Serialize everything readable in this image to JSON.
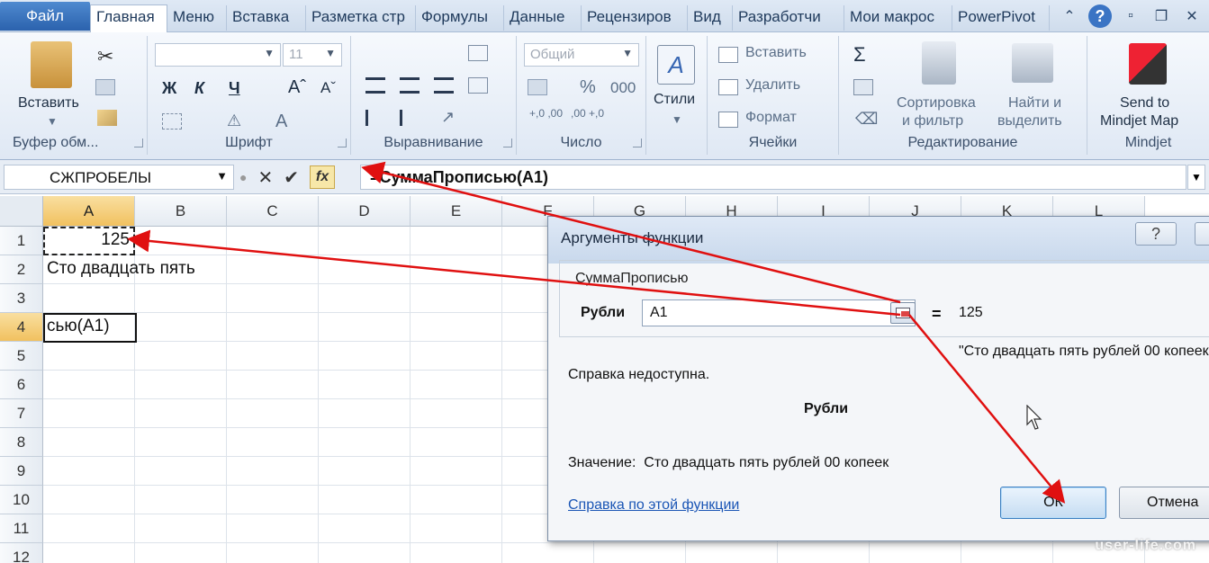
{
  "tabs": [
    {
      "label": "Файл"
    },
    {
      "label": "Главная"
    },
    {
      "label": "Меню"
    },
    {
      "label": "Вставка"
    },
    {
      "label": "Разметка стр"
    },
    {
      "label": "Формулы"
    },
    {
      "label": "Данные"
    },
    {
      "label": "Рецензиров"
    },
    {
      "label": "Вид"
    },
    {
      "label": "Разработчи"
    },
    {
      "label": "Мои макрос"
    },
    {
      "label": "PowerPivot"
    }
  ],
  "ribbon": {
    "clipboard": {
      "paste_label": "Вставить",
      "group_label": "Буфер обм..."
    },
    "font": {
      "font_size": "11",
      "bold": "Ж",
      "italic": "К",
      "underline": "Ч",
      "group_label": "Шрифт"
    },
    "alignment": {
      "group_label": "Выравнивание"
    },
    "number": {
      "format": "Общий",
      "percent": "%",
      "thousands": "000",
      "inc_dec": "+,0 ,00",
      "dec_dec": ",00 +,0",
      "group_label": "Число"
    },
    "styles": {
      "label": "Стили"
    },
    "cells": {
      "insert": "Вставить",
      "delete": "Удалить",
      "format": "Формат",
      "group_label": "Ячейки"
    },
    "editing": {
      "sigma": "Σ",
      "sort": "Сортировка",
      "sort2": "и фильтр",
      "find": "Найти и",
      "find2": "выделить",
      "group_label": "Редактирование"
    },
    "mindjet": {
      "send1": "Send to",
      "send2": "Mindjet Map",
      "group_label": "Mindjet"
    }
  },
  "formula_bar": {
    "name_box": "СЖПРОБЕЛЫ",
    "fx_label": "fx",
    "formula": "=СуммаПрописью(A1)"
  },
  "grid": {
    "columns": [
      "A",
      "B",
      "C",
      "D",
      "E",
      "F",
      "G",
      "H",
      "I",
      "J",
      "K",
      "L"
    ],
    "rows": [
      "1",
      "2",
      "3",
      "4",
      "5",
      "6",
      "7",
      "8",
      "9",
      "10",
      "11",
      "12"
    ],
    "cells": {
      "A1": "125",
      "A2": "Сто двадцать пять",
      "A4": "сью(A1)"
    }
  },
  "dialog": {
    "title": "Аргументы функции",
    "help_btn": "?",
    "function_name": "СуммаПрописью",
    "arg_label": "Рубли",
    "arg_value": "A1",
    "arg_result": "125",
    "result_preview": "\"Сто двадцать пять рублей 00 копеек\"",
    "help_note": "Справка недоступна.",
    "arg_description": "Рубли",
    "value_label": "Значение:",
    "value_text": "Сто двадцать пять рублей 00 копеек",
    "help_link": "Справка по этой функции",
    "ok_label": "ОК",
    "cancel_label": "Отмена"
  },
  "watermark": "user-life.com",
  "colors": {
    "arrow": "#e01010",
    "file_tab": "#2b62ad",
    "selected_header": "#f1c15f"
  }
}
